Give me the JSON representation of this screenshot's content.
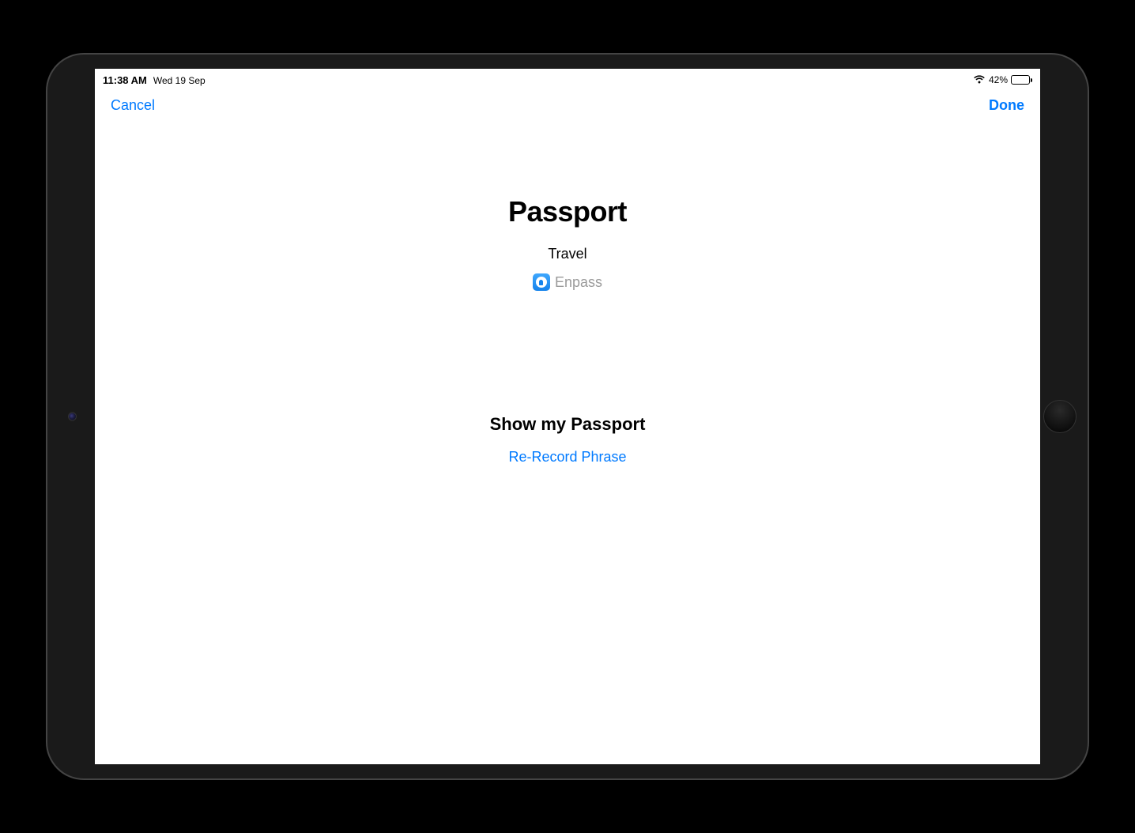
{
  "statusBar": {
    "time": "11:38 AM",
    "date": "Wed 19 Sep",
    "batteryPercent": "42%"
  },
  "nav": {
    "cancel": "Cancel",
    "done": "Done"
  },
  "shortcut": {
    "title": "Passport",
    "category": "Travel",
    "appName": "Enpass"
  },
  "phrase": {
    "label": "Show my Passport",
    "rerecord": "Re-Record Phrase"
  }
}
